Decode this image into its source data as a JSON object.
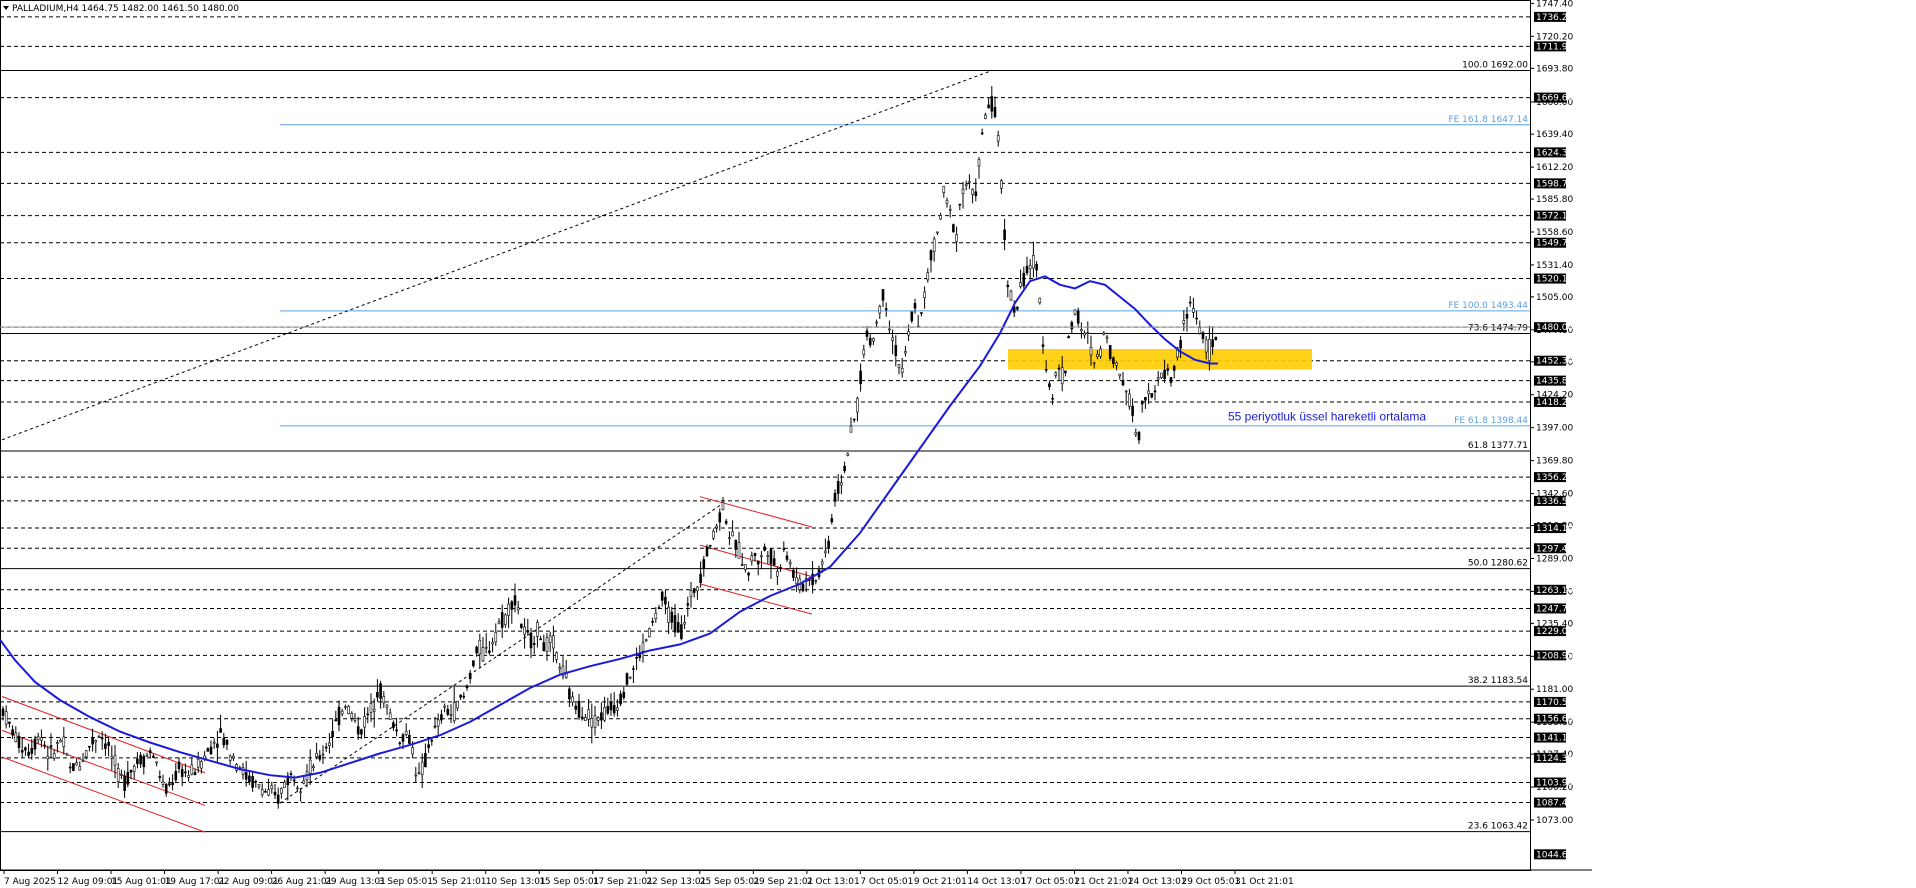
{
  "header": {
    "symbol_line": "PALLADIUM,H4  1464.75 1482.00 1461.50 1480.00"
  },
  "colors": {
    "background": "#ffffff",
    "candle": "#000000",
    "ema": "#1a1adb",
    "fe_line": "#5aa0e6",
    "fib_line": "#000000",
    "level_line": "#000000",
    "channel": "#e02020",
    "zone": "#ffcc00",
    "price_tag_bg": "#000000",
    "price_tag_fg": "#ffffff"
  },
  "chart_data": {
    "type": "candlestick",
    "title": "PALLADIUM,H4",
    "ohlc_last": {
      "open": 1464.75,
      "high": 1482.0,
      "low": 1461.5,
      "close": 1480.0
    },
    "ylim": [
      1031.7,
      1750.2
    ],
    "y_tick_labels": [
      "1747.40",
      "1720.20",
      "1693.80",
      "1666.00",
      "1639.40",
      "1612.20",
      "1585.80",
      "1558.60",
      "1531.40",
      "1505.00",
      "1477.80",
      "1451.40",
      "1424.20",
      "1397.00",
      "1369.80",
      "1342.60",
      "1316.20",
      "1289.00",
      "1261.80",
      "1235.40",
      "1208.20",
      "1181.00",
      "1153.80",
      "1127.40",
      "1100.20",
      "1073.00"
    ],
    "x_labels": [
      "7 Aug 2025",
      "12 Aug 09:01",
      "15 Aug 01:01",
      "19 Aug 17:01",
      "22 Aug 09:01",
      "26 Aug 21:01",
      "29 Aug 13:01",
      "3 Sep 05:01",
      "5 Sep 21:01",
      "10 Sep 13:01",
      "15 Sep 05:01",
      "17 Sep 21:01",
      "22 Sep 13:01",
      "25 Sep 05:01",
      "29 Sep 21:01",
      "2 Oct 13:01",
      "7 Oct 05:01",
      "9 Oct 21:01",
      "14 Oct 13:01",
      "17 Oct 05:01",
      "21 Oct 21:01",
      "24 Oct 13:01",
      "29 Oct 05:01",
      "31 Oct 21:01"
    ],
    "price_tags": [
      "1736.25",
      "1711.90",
      "1669.60",
      "1624.35",
      "1598.75",
      "1572.15",
      "1549.75",
      "1520.15",
      "1480.00",
      "1452.30",
      "1435.85",
      "1418.25",
      "1356.20",
      "1336.50",
      "1314.10",
      "1297.40",
      "1263.10",
      "1247.70",
      "1229.00",
      "1208.95",
      "1170.50",
      "1156.65",
      "1141.10",
      "1124.35",
      "1103.95",
      "1087.40",
      "1044.65"
    ],
    "level_values": [
      1736.25,
      1711.9,
      1669.6,
      1624.35,
      1598.75,
      1572.15,
      1549.75,
      1520.15,
      1480.0,
      1452.3,
      1435.85,
      1418.25,
      1356.2,
      1336.5,
      1314.1,
      1297.4,
      1263.1,
      1247.7,
      1229.0,
      1208.95,
      1170.5,
      1156.65,
      1141.1,
      1124.35,
      1103.95,
      1087.4
    ],
    "fib_levels": [
      {
        "label": "100.0 1692.00",
        "value": 1692.0
      },
      {
        "label": "73.6 1474.79",
        "value": 1474.79
      },
      {
        "label": "61.8 1377.71",
        "value": 1377.71
      },
      {
        "label": "50.0 1280.62",
        "value": 1280.62
      },
      {
        "label": "38.2 1183.54",
        "value": 1183.54
      },
      {
        "label": "23.6 1063.42",
        "value": 1063.42
      }
    ],
    "fe_levels": [
      {
        "label": "FE 161.8 1647.14",
        "value": 1647.14
      },
      {
        "label": "FE 100.0 1493.44",
        "value": 1493.44
      },
      {
        "label": "FE 61.8 1398.44",
        "value": 1398.44
      }
    ],
    "zone": {
      "low": 1445.0,
      "high": 1462.0
    },
    "annotation": "55 periyotluk üssel hareketli ortalama",
    "ema_period": 55,
    "price_path": [
      [
        0,
        1170
      ],
      [
        10,
        1150
      ],
      [
        20,
        1135
      ],
      [
        30,
        1130
      ],
      [
        40,
        1145
      ],
      [
        50,
        1125
      ],
      [
        62,
        1140
      ],
      [
        70,
        1115
      ],
      [
        80,
        1120
      ],
      [
        90,
        1135
      ],
      [
        100,
        1145
      ],
      [
        110,
        1130
      ],
      [
        118,
        1110
      ],
      [
        125,
        1105
      ],
      [
        135,
        1120
      ],
      [
        145,
        1125
      ],
      [
        152,
        1130
      ],
      [
        160,
        1110
      ],
      [
        165,
        1095
      ],
      [
        172,
        1105
      ],
      [
        180,
        1115
      ],
      [
        190,
        1110
      ],
      [
        200,
        1120
      ],
      [
        212,
        1135
      ],
      [
        220,
        1145
      ],
      [
        230,
        1130
      ],
      [
        238,
        1120
      ],
      [
        245,
        1110
      ],
      [
        252,
        1105
      ],
      [
        260,
        1100
      ],
      [
        268,
        1095
      ],
      [
        278,
        1090
      ],
      [
        285,
        1105
      ],
      [
        292,
        1110
      ],
      [
        300,
        1105
      ],
      [
        310,
        1115
      ],
      [
        320,
        1125
      ],
      [
        330,
        1140
      ],
      [
        340,
        1160
      ],
      [
        345,
        1170
      ],
      [
        352,
        1160
      ],
      [
        360,
        1145
      ],
      [
        365,
        1155
      ],
      [
        372,
        1165
      ],
      [
        378,
        1185
      ],
      [
        385,
        1170
      ],
      [
        392,
        1155
      ],
      [
        400,
        1140
      ],
      [
        406,
        1145
      ],
      [
        412,
        1135
      ],
      [
        418,
        1105
      ],
      [
        425,
        1120
      ],
      [
        430,
        1140
      ],
      [
        438,
        1150
      ],
      [
        445,
        1165
      ],
      [
        452,
        1160
      ],
      [
        458,
        1170
      ],
      [
        465,
        1175
      ],
      [
        472,
        1200
      ],
      [
        478,
        1215
      ],
      [
        485,
        1210
      ],
      [
        492,
        1220
      ],
      [
        498,
        1235
      ],
      [
        505,
        1240
      ],
      [
        512,
        1255
      ],
      [
        518,
        1250
      ],
      [
        522,
        1230
      ],
      [
        530,
        1220
      ],
      [
        538,
        1230
      ],
      [
        545,
        1215
      ],
      [
        552,
        1220
      ],
      [
        558,
        1205
      ],
      [
        565,
        1190
      ],
      [
        572,
        1170
      ],
      [
        580,
        1165
      ],
      [
        588,
        1160
      ],
      [
        595,
        1155
      ],
      [
        602,
        1160
      ],
      [
        610,
        1165
      ],
      [
        618,
        1170
      ],
      [
        625,
        1185
      ],
      [
        632,
        1195
      ],
      [
        640,
        1210
      ],
      [
        648,
        1225
      ],
      [
        655,
        1240
      ],
      [
        662,
        1255
      ],
      [
        668,
        1245
      ],
      [
        675,
        1235
      ],
      [
        682,
        1230
      ],
      [
        690,
        1255
      ],
      [
        698,
        1270
      ],
      [
        705,
        1290
      ],
      [
        712,
        1305
      ],
      [
        718,
        1320
      ],
      [
        724,
        1335
      ],
      [
        730,
        1305
      ],
      [
        736,
        1300
      ],
      [
        742,
        1290
      ],
      [
        748,
        1275
      ],
      [
        754,
        1295
      ],
      [
        760,
        1285
      ],
      [
        766,
        1300
      ],
      [
        772,
        1290
      ],
      [
        778,
        1275
      ],
      [
        784,
        1300
      ],
      [
        790,
        1285
      ],
      [
        796,
        1270
      ],
      [
        802,
        1265
      ],
      [
        808,
        1275
      ],
      [
        815,
        1270
      ],
      [
        822,
        1285
      ],
      [
        828,
        1300
      ],
      [
        835,
        1340
      ],
      [
        842,
        1355
      ],
      [
        850,
        1385
      ],
      [
        858,
        1420
      ],
      [
        866,
        1475
      ],
      [
        872,
        1465
      ],
      [
        878,
        1490
      ],
      [
        884,
        1510
      ],
      [
        890,
        1480
      ],
      [
        896,
        1460
      ],
      [
        902,
        1440
      ],
      [
        908,
        1470
      ],
      [
        914,
        1500
      ],
      [
        920,
        1480
      ],
      [
        926,
        1515
      ],
      [
        932,
        1540
      ],
      [
        938,
        1560
      ],
      [
        944,
        1590
      ],
      [
        950,
        1575
      ],
      [
        956,
        1555
      ],
      [
        962,
        1595
      ],
      [
        968,
        1600
      ],
      [
        974,
        1585
      ],
      [
        980,
        1620
      ],
      [
        986,
        1660
      ],
      [
        992,
        1665
      ],
      [
        996,
        1650
      ],
      [
        1000,
        1620
      ],
      [
        1004,
        1560
      ],
      [
        1008,
        1520
      ],
      [
        1012,
        1500
      ],
      [
        1016,
        1490
      ],
      [
        1020,
        1510
      ],
      [
        1026,
        1525
      ],
      [
        1032,
        1535
      ],
      [
        1038,
        1520
      ],
      [
        1044,
        1460
      ],
      [
        1048,
        1440
      ],
      [
        1052,
        1420
      ],
      [
        1058,
        1450
      ],
      [
        1064,
        1435
      ],
      [
        1070,
        1480
      ],
      [
        1076,
        1495
      ],
      [
        1082,
        1475
      ],
      [
        1088,
        1470
      ],
      [
        1094,
        1450
      ],
      [
        1100,
        1460
      ],
      [
        1106,
        1480
      ],
      [
        1112,
        1455
      ],
      [
        1118,
        1445
      ],
      [
        1124,
        1435
      ],
      [
        1130,
        1420
      ],
      [
        1134,
        1405
      ],
      [
        1138,
        1380
      ],
      [
        1142,
        1420
      ],
      [
        1148,
        1430
      ],
      [
        1154,
        1420
      ],
      [
        1160,
        1440
      ],
      [
        1166,
        1445
      ],
      [
        1172,
        1435
      ],
      [
        1178,
        1460
      ],
      [
        1184,
        1480
      ],
      [
        1190,
        1500
      ],
      [
        1196,
        1490
      ],
      [
        1202,
        1475
      ],
      [
        1208,
        1460
      ],
      [
        1214,
        1465
      ],
      [
        1218,
        1480
      ]
    ],
    "ema_path": [
      [
        0,
        1222
      ],
      [
        15,
        1205
      ],
      [
        35,
        1187
      ],
      [
        60,
        1172
      ],
      [
        90,
        1158
      ],
      [
        120,
        1146
      ],
      [
        150,
        1137
      ],
      [
        180,
        1129
      ],
      [
        210,
        1122
      ],
      [
        240,
        1115
      ],
      [
        270,
        1110
      ],
      [
        295,
        1108
      ],
      [
        320,
        1112
      ],
      [
        350,
        1120
      ],
      [
        380,
        1128
      ],
      [
        410,
        1135
      ],
      [
        440,
        1143
      ],
      [
        470,
        1154
      ],
      [
        500,
        1168
      ],
      [
        530,
        1182
      ],
      [
        560,
        1193
      ],
      [
        590,
        1200
      ],
      [
        620,
        1206
      ],
      [
        650,
        1213
      ],
      [
        680,
        1218
      ],
      [
        710,
        1227
      ],
      [
        740,
        1245
      ],
      [
        770,
        1258
      ],
      [
        800,
        1268
      ],
      [
        830,
        1282
      ],
      [
        860,
        1310
      ],
      [
        890,
        1345
      ],
      [
        920,
        1380
      ],
      [
        950,
        1415
      ],
      [
        980,
        1448
      ],
      [
        1000,
        1475
      ],
      [
        1015,
        1500
      ],
      [
        1030,
        1518
      ],
      [
        1045,
        1522
      ],
      [
        1060,
        1515
      ],
      [
        1075,
        1512
      ],
      [
        1090,
        1518
      ],
      [
        1105,
        1515
      ],
      [
        1120,
        1505
      ],
      [
        1135,
        1495
      ],
      [
        1150,
        1482
      ],
      [
        1165,
        1470
      ],
      [
        1180,
        1460
      ],
      [
        1195,
        1453
      ],
      [
        1210,
        1450
      ],
      [
        1218,
        1450
      ]
    ],
    "channel_lines": [
      {
        "x1": 2,
        "y1": 1175,
        "x2": 205,
        "y2": 1112
      },
      {
        "x1": 2,
        "y1": 1147,
        "x2": 205,
        "y2": 1085
      },
      {
        "x1": 2,
        "y1": 1125,
        "x2": 205,
        "y2": 1063
      },
      {
        "x1": 700,
        "y1": 1340,
        "x2": 812,
        "y2": 1315
      },
      {
        "x1": 700,
        "y1": 1300,
        "x2": 812,
        "y2": 1274
      },
      {
        "x1": 700,
        "y1": 1268,
        "x2": 812,
        "y2": 1243
      }
    ],
    "trend_lines": [
      {
        "x1": 2,
        "y1": 1387,
        "x2": 992,
        "y2": 1692
      },
      {
        "x1": 280,
        "y1": 1087,
        "x2": 724,
        "y2": 1335
      }
    ]
  }
}
